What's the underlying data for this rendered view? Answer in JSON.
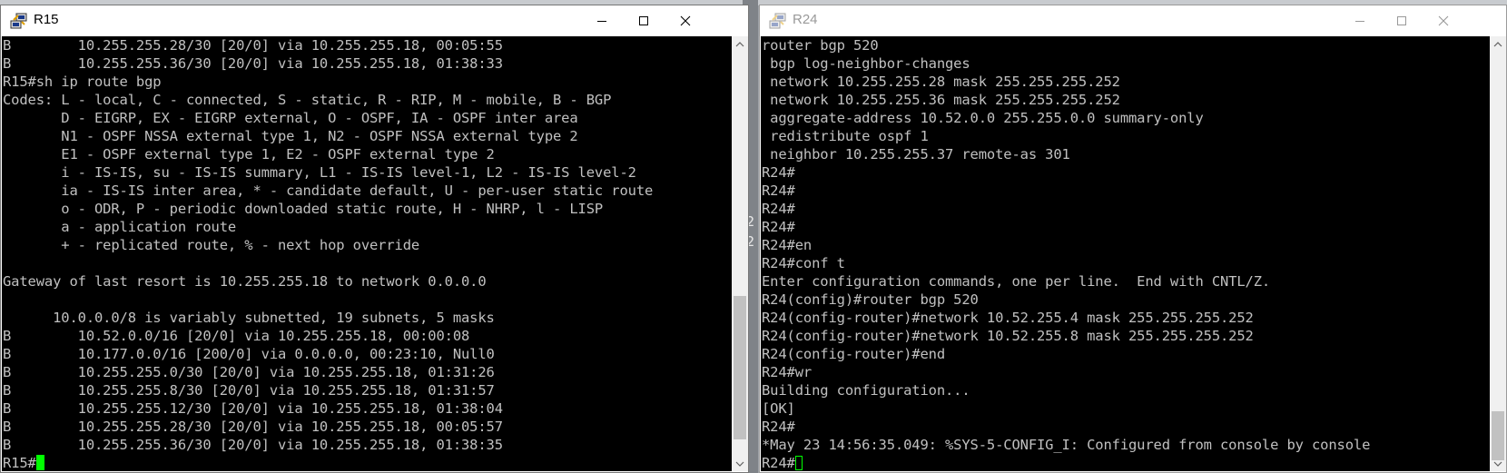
{
  "colors": {
    "terminal_bg": "#000000",
    "terminal_fg": "#c0c0c0",
    "cursor": "#00ff00",
    "scroll_thumb": "#c1c1c1"
  },
  "background": {
    "gap_glyphs": [
      "2",
      "2"
    ]
  },
  "left_window": {
    "title": "R15",
    "icon": "putty-icon",
    "lines": [
      "B        10.255.255.28/30 [20/0] via 10.255.255.18, 00:05:55",
      "B        10.255.255.36/30 [20/0] via 10.255.255.18, 01:38:33",
      "R15#sh ip route bgp",
      "Codes: L - local, C - connected, S - static, R - RIP, M - mobile, B - BGP",
      "       D - EIGRP, EX - EIGRP external, O - OSPF, IA - OSPF inter area",
      "       N1 - OSPF NSSA external type 1, N2 - OSPF NSSA external type 2",
      "       E1 - OSPF external type 1, E2 - OSPF external type 2",
      "       i - IS-IS, su - IS-IS summary, L1 - IS-IS level-1, L2 - IS-IS level-2",
      "       ia - IS-IS inter area, * - candidate default, U - per-user static route",
      "       o - ODR, P - periodic downloaded static route, H - NHRP, l - LISP",
      "       a - application route",
      "       + - replicated route, % - next hop override",
      "",
      "Gateway of last resort is 10.255.255.18 to network 0.0.0.0",
      "",
      "      10.0.0.0/8 is variably subnetted, 19 subnets, 5 masks",
      "B        10.52.0.0/16 [20/0] via 10.255.255.18, 00:00:08",
      "B        10.177.0.0/16 [200/0] via 0.0.0.0, 00:23:10, Null0",
      "B        10.255.255.0/30 [20/0] via 10.255.255.18, 01:31:26",
      "B        10.255.255.8/30 [20/0] via 10.255.255.18, 01:31:57",
      "B        10.255.255.12/30 [20/0] via 10.255.255.18, 01:38:04",
      "B        10.255.255.28/30 [20/0] via 10.255.255.18, 00:05:57",
      "B        10.255.255.36/30 [20/0] via 10.255.255.18, 01:38:35"
    ],
    "prompt": "R15#"
  },
  "right_window": {
    "title": "R24",
    "icon": "putty-icon",
    "lines": [
      "router bgp 520",
      " bgp log-neighbor-changes",
      " network 10.255.255.28 mask 255.255.255.252",
      " network 10.255.255.36 mask 255.255.255.252",
      " aggregate-address 10.52.0.0 255.255.0.0 summary-only",
      " redistribute ospf 1",
      " neighbor 10.255.255.37 remote-as 301",
      "R24#",
      "R24#",
      "R24#",
      "R24#",
      "R24#en",
      "R24#conf t",
      "Enter configuration commands, one per line.  End with CNTL/Z.",
      "R24(config)#router bgp 520",
      "R24(config-router)#network 10.52.255.4 mask 255.255.255.252",
      "R24(config-router)#network 10.52.255.8 mask 255.255.255.252",
      "R24(config-router)#end",
      "R24#wr",
      "Building configuration...",
      "[OK]",
      "R24#",
      "*May 23 14:56:35.049: %SYS-5-CONFIG_I: Configured from console by console"
    ],
    "prompt": "R24#"
  }
}
